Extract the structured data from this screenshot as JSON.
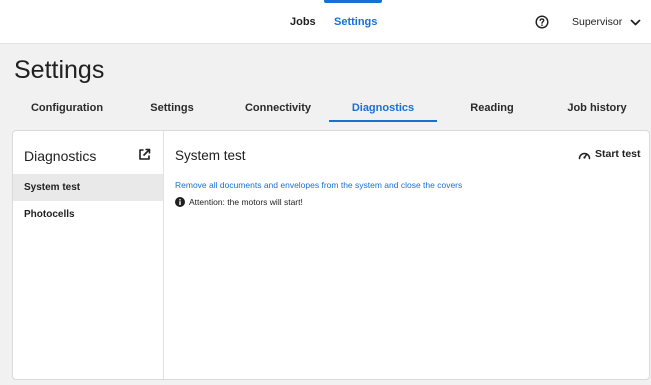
{
  "topbar": {
    "nav_jobs": "Jobs",
    "nav_settings": "Settings",
    "help_icon": "question-circle-icon",
    "user": "Supervisor",
    "user_chevron_icon": "chevron-down-icon"
  },
  "page": {
    "title": "Settings"
  },
  "tabs": [
    {
      "label": "Configuration"
    },
    {
      "label": "Settings"
    },
    {
      "label": "Connectivity"
    },
    {
      "label": "Diagnostics",
      "active": true
    },
    {
      "label": "Reading"
    },
    {
      "label": "Job history"
    }
  ],
  "sidebar": {
    "title": "Diagnostics",
    "external_icon": "external-link-icon",
    "items": [
      {
        "label": "System test",
        "active": true
      },
      {
        "label": "Photocells"
      }
    ]
  },
  "content": {
    "title": "System test",
    "start_button": "Start test",
    "start_icon": "gauge-icon",
    "instruction": "Remove all documents and envelopes from the system and close the covers",
    "attention_icon": "info-icon",
    "attention": "Attention: the motors will start!"
  },
  "colors": {
    "accent": "#1a6fd6",
    "background": "#f1f1f1",
    "selected_row": "#e9e9e9"
  }
}
